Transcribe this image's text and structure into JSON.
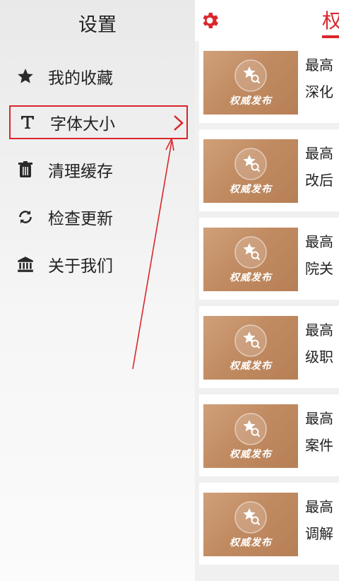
{
  "drawer": {
    "title": "设置",
    "items": [
      {
        "label": "我的收藏",
        "icon": "star-icon"
      },
      {
        "label": "字体大小",
        "icon": "font-size-icon"
      },
      {
        "label": "清理缓存",
        "icon": "trash-icon"
      },
      {
        "label": "检查更新",
        "icon": "refresh-icon"
      },
      {
        "label": "关于我们",
        "icon": "institution-icon"
      }
    ]
  },
  "topbar": {
    "title": "权",
    "icon": "gear-icon",
    "accent": "#d9262c"
  },
  "cards": [
    {
      "badge": "权威发布",
      "line1": "最高",
      "line2": "深化"
    },
    {
      "badge": "权威发布",
      "line1": "最高",
      "line2": "改后"
    },
    {
      "badge": "权威发布",
      "line1": "最高",
      "line2": "院关"
    },
    {
      "badge": "权威发布",
      "line1": "最高",
      "line2": "级职"
    },
    {
      "badge": "权威发布",
      "line1": "最高",
      "line2": "案件"
    },
    {
      "badge": "权威发布",
      "line1": "最高",
      "line2": "调解"
    }
  ]
}
